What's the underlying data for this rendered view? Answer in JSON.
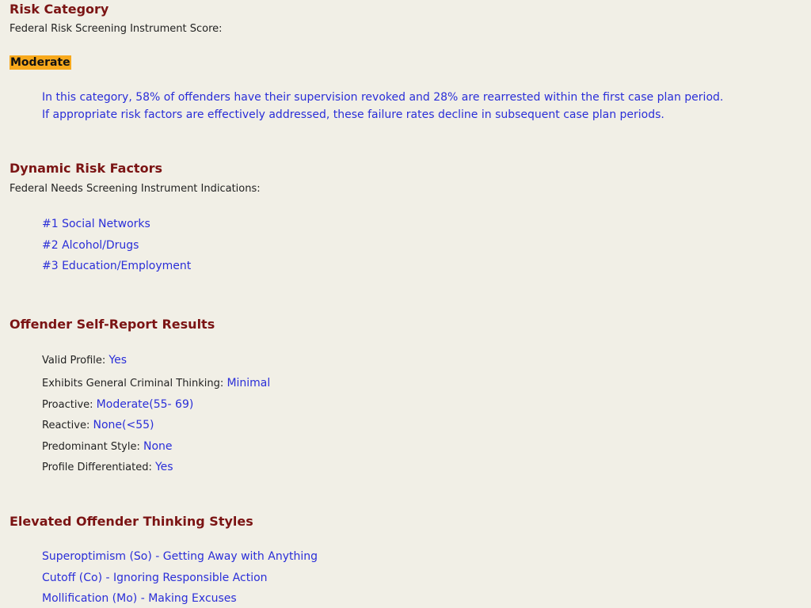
{
  "risk_category": {
    "title": "Risk Category",
    "subtitle": "Federal Risk Screening Instrument Score:",
    "score": "Moderate",
    "description_lines": [
      "In this category, 58% of offenders have their supervision revoked and 28% are rearrested within the first case plan period.",
      "If appropriate risk factors are effectively addressed, these failure rates decline in subsequent case plan periods."
    ],
    "highlight_color": "#f8a91c"
  },
  "dynamic_risk_factors": {
    "title": "Dynamic Risk Factors",
    "subtitle": "Federal Needs Screening Instrument Indications:",
    "items": [
      "#1 Social Networks",
      "#2 Alcohol/Drugs",
      "#3 Education/Employment"
    ]
  },
  "self_report": {
    "title": "Offender Self-Report Results",
    "rows": [
      {
        "label": "Valid Profile:",
        "value": "Yes"
      },
      {
        "label": "Exhibits General Criminal Thinking:",
        "value": "Minimal"
      },
      {
        "label": "Proactive:",
        "value": "Moderate(55- 69)"
      },
      {
        "label": "Reactive:",
        "value": "None(<55)"
      },
      {
        "label": "Predominant Style:",
        "value": "None"
      },
      {
        "label": "Profile Differentiated:",
        "value": "Yes"
      }
    ]
  },
  "thinking_styles": {
    "title": "Elevated Offender Thinking Styles",
    "items": [
      "Superoptimism (So) - Getting Away with Anything",
      "Cutoff (Co) - Ignoring Responsible Action",
      "Mollification (Mo) - Making Excuses"
    ]
  },
  "colors": {
    "heading": "#7b1414",
    "value_text": "#2a2ed8",
    "background": "#f1efe6"
  }
}
